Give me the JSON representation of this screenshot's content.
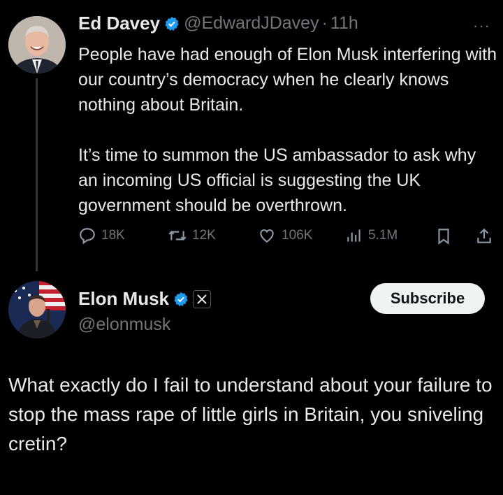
{
  "tweet1": {
    "name": "Ed Davey",
    "handle": "@EdwardJDavey",
    "separator": "·",
    "time": "11h",
    "more": "···",
    "paragraph1": "People have had enough of Elon Musk interfering with our country’s democracy when he clearly knows nothing about Britain.",
    "paragraph2": "It’s time to summon the US ambassador to ask why an incoming US official is suggesting the UK government should be overthrown.",
    "stats": {
      "replies": "18K",
      "reposts": "12K",
      "likes": "106K",
      "views": "5.1M"
    }
  },
  "tweet2": {
    "name": "Elon Musk",
    "handle": "@elonmusk",
    "subscribe_label": "Subscribe",
    "text": "What exactly do I fail to understand about your failure to stop the mass rape of little girls in Britain, you sniveling cretin?"
  },
  "colors": {
    "background": "#000000",
    "text": "#e7e9ea",
    "muted": "#71767b",
    "verified": "#1d9bf0"
  },
  "icons": [
    "verified-badge-icon",
    "more-icon",
    "reply-icon",
    "repost-icon",
    "like-icon",
    "views-icon",
    "bookmark-icon",
    "share-icon",
    "x-logo-icon"
  ]
}
